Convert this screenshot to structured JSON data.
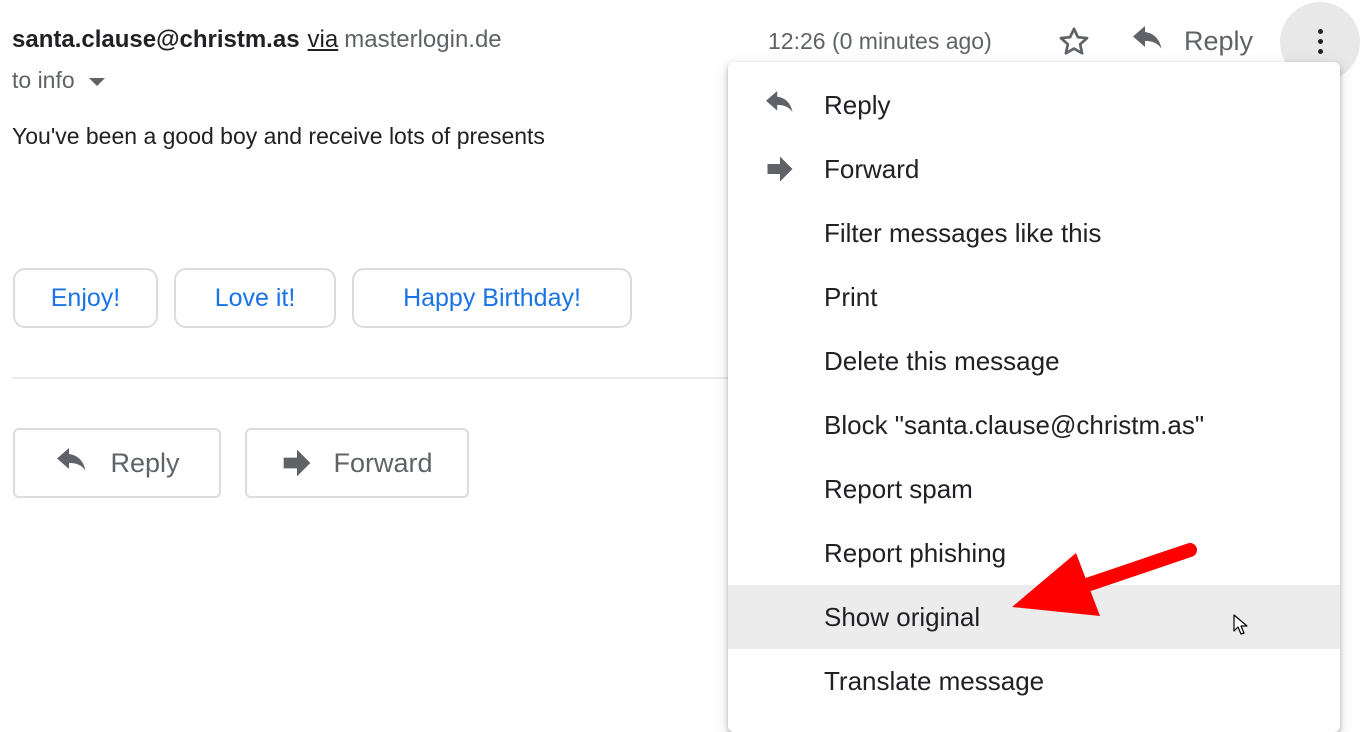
{
  "header": {
    "sender": "santa.clause@christm.as",
    "via_label": "via",
    "via_domain": "masterlogin.de",
    "recipient": "to info",
    "timestamp": "12:26 (0 minutes ago)",
    "reply_label": "Reply",
    "icons": {
      "star": "star-outline-icon",
      "reply": "reply-icon",
      "more": "more-vert-icon",
      "recipient_details": "arrow-drop-down-icon"
    }
  },
  "message": {
    "body": "You've been a good boy and receive lots of presents",
    "smart_replies": [
      "Enjoy!",
      "Love it!",
      "Happy Birthday!"
    ],
    "smart_reply_color": "#1a73e8"
  },
  "actions": {
    "reply_label": "Reply",
    "forward_label": "Forward"
  },
  "menu": {
    "items": [
      {
        "label": "Reply",
        "icon": "reply-icon"
      },
      {
        "label": "Forward",
        "icon": "forward-icon"
      },
      {
        "label": "Filter messages like this"
      },
      {
        "label": "Print"
      },
      {
        "label": "Delete this message"
      },
      {
        "label": "Block \"santa.clause@christm.as\""
      },
      {
        "label": "Report spam"
      },
      {
        "label": "Report phishing"
      },
      {
        "label": "Show original",
        "highlighted": true
      },
      {
        "label": "Translate message"
      }
    ],
    "highlight_color": "#ececec"
  },
  "annotation": {
    "type": "arrow",
    "color": "#ff0000",
    "points_to": "Show original"
  }
}
